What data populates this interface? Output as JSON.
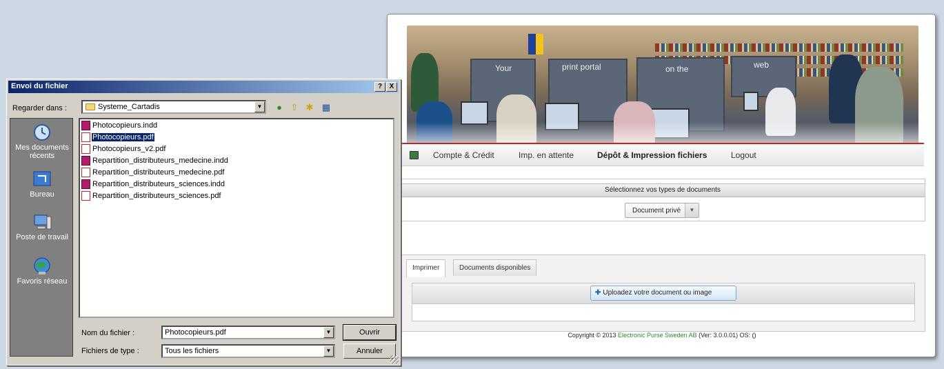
{
  "portal": {
    "banner": {
      "words": [
        "Your",
        "print portal",
        "on the",
        "web"
      ]
    },
    "menu": {
      "items": [
        "Compte & Crédit",
        "Imp. en attente",
        "Dépôt & Impression fichiers",
        "Logout"
      ]
    },
    "doc_types": {
      "header": "Sélectionnez vos types de documents",
      "selected": "Document privé"
    },
    "tabs": [
      "Imprimer",
      "Documents disponibles"
    ],
    "upload_button": "Uploadez votre document ou image",
    "footer": {
      "prefix": "Copyright © 2013",
      "company": "Electronic Purse Sweden AB",
      "suffix": "(Ver: 3.0.0.01) OS: ()"
    }
  },
  "dialog": {
    "title": "Envoi du fichier",
    "help_button": "?",
    "close_button": "X",
    "look_in_label": "Regarder dans :",
    "look_in_value": "Systeme_Cartadis",
    "places": [
      "Mes documents récents",
      "Bureau",
      "Poste de travail",
      "Favoris réseau"
    ],
    "files": [
      {
        "name": "Photocopieurs.indd",
        "type": "indd"
      },
      {
        "name": "Photocopieurs.pdf",
        "type": "pdf",
        "selected": true
      },
      {
        "name": "Photocopieurs_v2.pdf",
        "type": "pdf"
      },
      {
        "name": "Repartition_distributeurs_medecine.indd",
        "type": "indd"
      },
      {
        "name": "Repartition_distributeurs_medecine.pdf",
        "type": "pdf"
      },
      {
        "name": "Repartition_distributeurs_sciences.indd",
        "type": "indd"
      },
      {
        "name": "Repartition_distributeurs_sciences.pdf",
        "type": "pdf"
      }
    ],
    "filename_label": "Nom du fichier :",
    "filename_value": "Photocopieurs.pdf",
    "filetype_label": "Fichiers de type :",
    "filetype_value": "Tous les fichiers",
    "open_button": "Ouvrir",
    "cancel_button": "Annuler"
  }
}
